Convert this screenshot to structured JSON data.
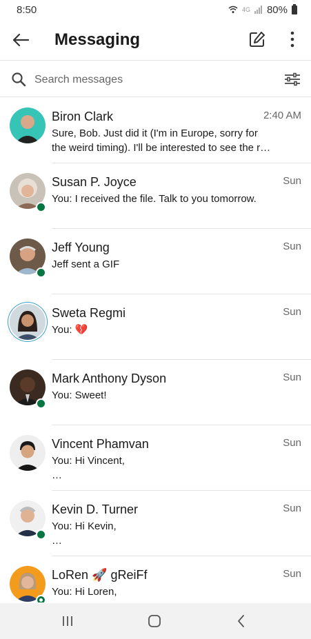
{
  "status_bar": {
    "time": "8:50",
    "network": "4G",
    "battery": "80%"
  },
  "header": {
    "title": "Messaging"
  },
  "search": {
    "placeholder": "Search messages"
  },
  "conversations": [
    {
      "name": "Biron Clark",
      "time": "2:40 AM",
      "preview": "Sure, Bob. Just did it (I'm in Europe, sorry for\nthe weird timing). I'll be interested to see the r…",
      "online": false
    },
    {
      "name": "Susan P. Joyce",
      "time": "Sun",
      "preview": "You: I received the file. Talk to you tomorrow.",
      "online": true
    },
    {
      "name": "Jeff Young",
      "time": "Sun",
      "preview": "Jeff sent a GIF",
      "online": true
    },
    {
      "name": "Sweta Regmi",
      "time": "Sun",
      "preview": "You: 💔",
      "online": false
    },
    {
      "name": "Mark Anthony Dyson",
      "time": "Sun",
      "preview": "You: Sweet!",
      "online": true
    },
    {
      "name": "Vincent Phamvan",
      "time": "Sun",
      "preview": "You: Hi Vincent,\n…",
      "online": false
    },
    {
      "name": "Kevin D. Turner",
      "time": "Sun",
      "preview": "You: Hi Kevin,\n…",
      "online": true
    },
    {
      "name": "LoRen 🚀 gReiFf",
      "time": "Sun",
      "preview": "You: Hi Loren,",
      "online": true
    }
  ],
  "colors": {
    "online": "#057642",
    "divider": "#e4e4e4",
    "nav_bg": "#f2f2f2"
  }
}
